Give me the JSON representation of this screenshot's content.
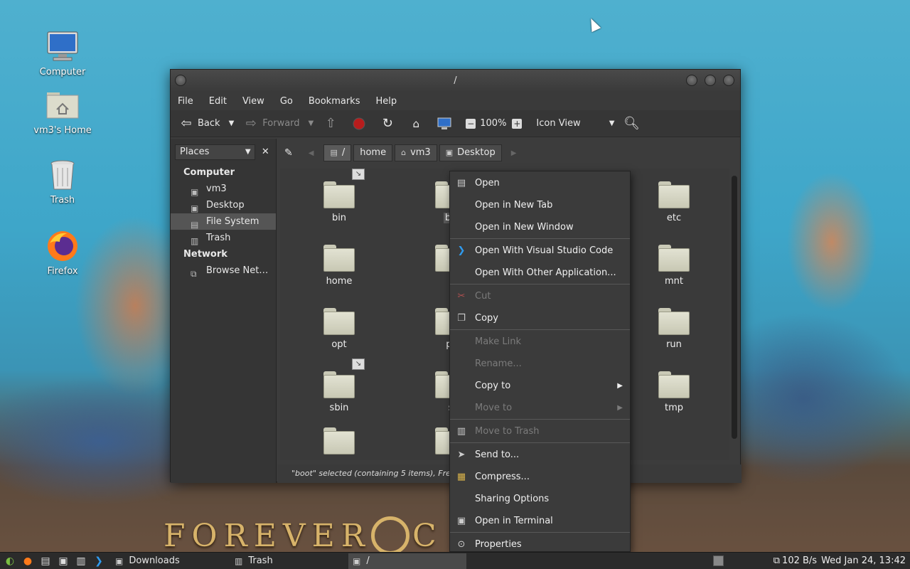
{
  "desktop": {
    "icons": [
      {
        "label": "Computer",
        "icon": "monitor-icon"
      },
      {
        "label": "vm3's Home",
        "icon": "home-folder-icon"
      },
      {
        "label": "Trash",
        "icon": "trash-icon"
      },
      {
        "label": "Firefox",
        "icon": "firefox-icon"
      }
    ],
    "banner_left": "FOREVER",
    "banner_right": "C      TIONS"
  },
  "window": {
    "title": "/",
    "menu": [
      "File",
      "Edit",
      "View",
      "Go",
      "Bookmarks",
      "Help"
    ],
    "toolbar": {
      "back": "Back",
      "forward": "Forward",
      "zoom": "100%",
      "view_mode": "Icon View"
    },
    "sidebar": {
      "selector": "Places",
      "sections": [
        {
          "title": "Computer",
          "items": [
            "vm3",
            "Desktop",
            "File System",
            "Trash"
          ]
        },
        {
          "title": "Network",
          "items": [
            "Browse Net…"
          ]
        }
      ],
      "selected": "File System"
    },
    "path": [
      "/",
      "home",
      "vm3",
      "Desktop"
    ],
    "files": [
      "bin",
      "bo",
      "etc",
      "home",
      "l",
      "mnt",
      "opt",
      "pr",
      "run",
      "sbin",
      "s",
      "tmp"
    ],
    "status": "\"boot\" selected (containing 5 items), Free spac"
  },
  "context_menu": {
    "items": [
      {
        "label": "Open",
        "icon": "open-icon",
        "enabled": true
      },
      {
        "label": "Open in New Tab",
        "enabled": true
      },
      {
        "label": "Open in New Window",
        "enabled": true
      },
      {
        "sep": true
      },
      {
        "label": "Open With Visual Studio Code",
        "icon": "vscode-icon",
        "enabled": true
      },
      {
        "label": "Open With Other Application...",
        "enabled": true
      },
      {
        "sep": true
      },
      {
        "label": "Cut",
        "icon": "scissors-icon",
        "enabled": false
      },
      {
        "label": "Copy",
        "icon": "copy-icon",
        "enabled": true
      },
      {
        "sep": true
      },
      {
        "label": "Make Link",
        "enabled": false
      },
      {
        "label": "Rename...",
        "enabled": false
      },
      {
        "label": "Copy to",
        "enabled": true,
        "submenu": true
      },
      {
        "label": "Move to",
        "enabled": false,
        "submenu": true
      },
      {
        "sep": true
      },
      {
        "label": "Move to Trash",
        "icon": "trash-icon",
        "enabled": false
      },
      {
        "sep": true
      },
      {
        "label": "Send to...",
        "icon": "send-icon",
        "enabled": true
      },
      {
        "label": "Compress...",
        "icon": "archive-icon",
        "enabled": true
      },
      {
        "label": "Sharing Options",
        "enabled": true
      },
      {
        "label": "Open in Terminal",
        "icon": "terminal-icon",
        "enabled": true
      },
      {
        "sep": true
      },
      {
        "label": "Properties",
        "icon": "properties-icon",
        "enabled": true
      }
    ]
  },
  "taskbar": {
    "tasks": [
      {
        "label": "Downloads",
        "icon": "folder-icon"
      },
      {
        "label": "Trash",
        "icon": "trash-icon"
      },
      {
        "label": "/",
        "icon": "folder-icon",
        "active": true
      }
    ],
    "net_speed": "102 B/s",
    "datetime": "Wed Jan 24, 13:42"
  }
}
